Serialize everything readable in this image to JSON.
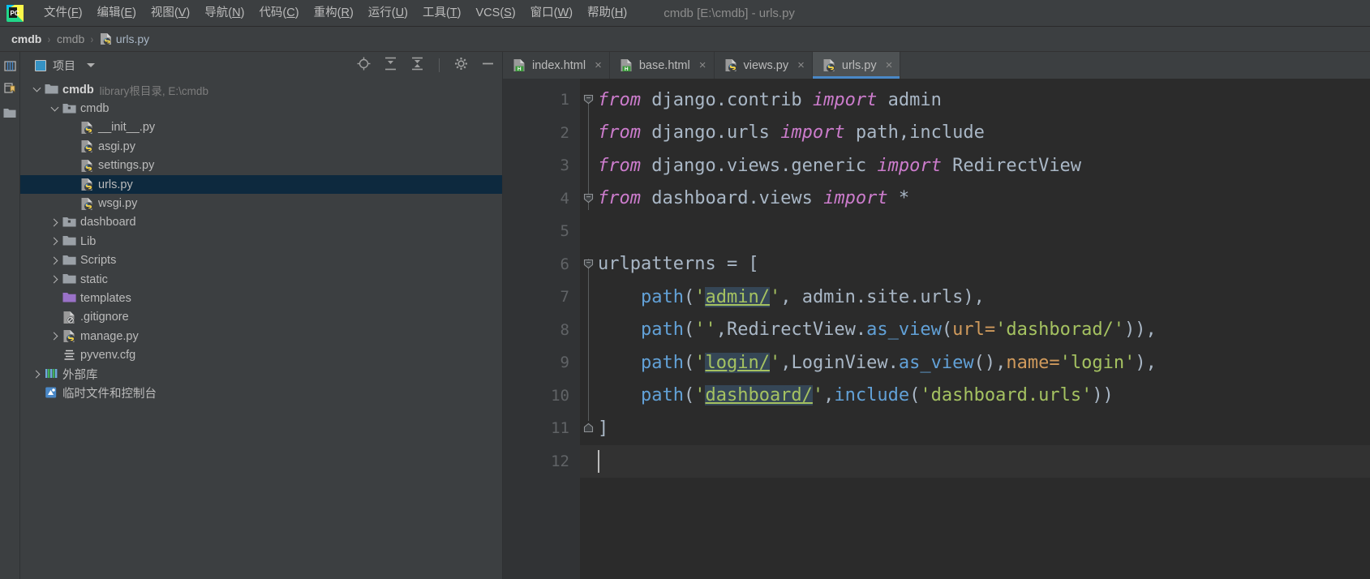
{
  "window": {
    "title": "cmdb [E:\\cmdb] - urls.py",
    "logo_text": "PC"
  },
  "menubar": {
    "items": [
      {
        "label": "文件",
        "mnemonic": "F"
      },
      {
        "label": "编辑",
        "mnemonic": "E"
      },
      {
        "label": "视图",
        "mnemonic": "V"
      },
      {
        "label": "导航",
        "mnemonic": "N"
      },
      {
        "label": "代码",
        "mnemonic": "C"
      },
      {
        "label": "重构",
        "mnemonic": "R"
      },
      {
        "label": "运行",
        "mnemonic": "U"
      },
      {
        "label": "工具",
        "mnemonic": "T"
      },
      {
        "label": "VCS",
        "mnemonic": "S"
      },
      {
        "label": "窗口",
        "mnemonic": "W"
      },
      {
        "label": "帮助",
        "mnemonic": "H"
      }
    ]
  },
  "breadcrumb": {
    "items": [
      "cmdb",
      "cmdb",
      "urls.py"
    ],
    "separator": "›"
  },
  "project_panel": {
    "title": "项目",
    "tools": [
      "locate-icon",
      "expand-all-icon",
      "collapse-all-icon",
      "gear-icon",
      "minimize-icon"
    ],
    "tree": [
      {
        "label": "cmdb",
        "sub": "library根目录, E:\\cmdb",
        "icon": "folder-root-icon",
        "arrow": "down",
        "indent": 0,
        "bold": true,
        "selected": false
      },
      {
        "label": "cmdb",
        "sub": "",
        "icon": "folder-source-icon",
        "arrow": "down",
        "indent": 1,
        "bold": false,
        "selected": false
      },
      {
        "label": "__init__.py",
        "sub": "",
        "icon": "python-file-icon",
        "arrow": "none",
        "indent": 2,
        "bold": false,
        "selected": false
      },
      {
        "label": "asgi.py",
        "sub": "",
        "icon": "python-file-icon",
        "arrow": "none",
        "indent": 2,
        "bold": false,
        "selected": false
      },
      {
        "label": "settings.py",
        "sub": "",
        "icon": "python-file-icon",
        "arrow": "none",
        "indent": 2,
        "bold": false,
        "selected": false
      },
      {
        "label": "urls.py",
        "sub": "",
        "icon": "python-file-icon",
        "arrow": "none",
        "indent": 2,
        "bold": false,
        "selected": true
      },
      {
        "label": "wsgi.py",
        "sub": "",
        "icon": "python-file-icon",
        "arrow": "none",
        "indent": 2,
        "bold": false,
        "selected": false
      },
      {
        "label": "dashboard",
        "sub": "",
        "icon": "folder-source-icon",
        "arrow": "right",
        "indent": 1,
        "bold": false,
        "selected": false
      },
      {
        "label": "Lib",
        "sub": "",
        "icon": "folder-icon",
        "arrow": "right",
        "indent": 1,
        "bold": false,
        "selected": false
      },
      {
        "label": "Scripts",
        "sub": "",
        "icon": "folder-icon",
        "arrow": "right",
        "indent": 1,
        "bold": false,
        "selected": false
      },
      {
        "label": "static",
        "sub": "",
        "icon": "folder-icon",
        "arrow": "right",
        "indent": 1,
        "bold": false,
        "selected": false
      },
      {
        "label": "templates",
        "sub": "",
        "icon": "folder-template-icon",
        "arrow": "none",
        "indent": 1,
        "bold": false,
        "selected": false
      },
      {
        "label": ".gitignore",
        "sub": "",
        "icon": "gitignore-file-icon",
        "arrow": "none",
        "indent": 1,
        "bold": false,
        "selected": false
      },
      {
        "label": "manage.py",
        "sub": "",
        "icon": "python-file-icon",
        "arrow": "right",
        "indent": 1,
        "bold": false,
        "selected": false
      },
      {
        "label": "pyvenv.cfg",
        "sub": "",
        "icon": "config-file-icon",
        "arrow": "none",
        "indent": 1,
        "bold": false,
        "selected": false
      },
      {
        "label": "外部库",
        "sub": "",
        "icon": "library-icon",
        "arrow": "right",
        "indent": 0,
        "bold": false,
        "selected": false
      },
      {
        "label": "临时文件和控制台",
        "sub": "",
        "icon": "scratches-icon",
        "arrow": "none",
        "indent": 0,
        "bold": false,
        "selected": false
      }
    ]
  },
  "editor": {
    "tabs": [
      {
        "label": "index.html",
        "icon": "html-file-icon",
        "active": false,
        "close": "×"
      },
      {
        "label": "base.html",
        "icon": "html-file-icon",
        "active": false,
        "close": "×"
      },
      {
        "label": "views.py",
        "icon": "python-file-icon",
        "active": false,
        "close": "×"
      },
      {
        "label": "urls.py",
        "icon": "python-file-icon",
        "active": true,
        "close": "×"
      }
    ],
    "line_numbers": [
      "1",
      "2",
      "3",
      "4",
      "5",
      "6",
      "7",
      "8",
      "9",
      "10",
      "11",
      "12"
    ],
    "code_lines": [
      {
        "n": 1,
        "fold": "minus",
        "tokens": [
          {
            "t": "from ",
            "c": "kw"
          },
          {
            "t": "django.contrib ",
            "c": "plain"
          },
          {
            "t": "import ",
            "c": "kw"
          },
          {
            "t": "admin",
            "c": "plain"
          }
        ]
      },
      {
        "n": 2,
        "fold": "",
        "tokens": [
          {
            "t": "from ",
            "c": "kw"
          },
          {
            "t": "django.urls ",
            "c": "plain"
          },
          {
            "t": "import ",
            "c": "kw"
          },
          {
            "t": "path,include",
            "c": "plain"
          }
        ]
      },
      {
        "n": 3,
        "fold": "",
        "tokens": [
          {
            "t": "from ",
            "c": "kw"
          },
          {
            "t": "django.views.generic ",
            "c": "plain"
          },
          {
            "t": "import ",
            "c": "kw"
          },
          {
            "t": "RedirectView",
            "c": "plain"
          }
        ]
      },
      {
        "n": 4,
        "fold": "minus",
        "tokens": [
          {
            "t": "from ",
            "c": "kw"
          },
          {
            "t": "dashboard.views ",
            "c": "plain"
          },
          {
            "t": "import ",
            "c": "kw"
          },
          {
            "t": "*",
            "c": "plain"
          }
        ]
      },
      {
        "n": 5,
        "fold": "",
        "tokens": []
      },
      {
        "n": 6,
        "fold": "minus",
        "tokens": [
          {
            "t": "urlpatterns = [",
            "c": "plain"
          }
        ]
      },
      {
        "n": 7,
        "fold": "",
        "tokens": [
          {
            "t": "    ",
            "c": "plain"
          },
          {
            "t": "path",
            "c": "fn"
          },
          {
            "t": "(",
            "c": "plain"
          },
          {
            "t": "'",
            "c": "str"
          },
          {
            "t": "admin/",
            "c": "strU"
          },
          {
            "t": "'",
            "c": "str"
          },
          {
            "t": ", admin.site.urls),",
            "c": "plain"
          }
        ]
      },
      {
        "n": 8,
        "fold": "",
        "tokens": [
          {
            "t": "    ",
            "c": "plain"
          },
          {
            "t": "path",
            "c": "fn"
          },
          {
            "t": "(",
            "c": "plain"
          },
          {
            "t": "''",
            "c": "str"
          },
          {
            "t": ",RedirectView.",
            "c": "plain"
          },
          {
            "t": "as_view",
            "c": "fn"
          },
          {
            "t": "(",
            "c": "plain"
          },
          {
            "t": "url=",
            "c": "arg"
          },
          {
            "t": "'dashborad/'",
            "c": "str"
          },
          {
            "t": ")),",
            "c": "plain"
          }
        ]
      },
      {
        "n": 9,
        "fold": "",
        "tokens": [
          {
            "t": "    ",
            "c": "plain"
          },
          {
            "t": "path",
            "c": "fn"
          },
          {
            "t": "(",
            "c": "plain"
          },
          {
            "t": "'",
            "c": "str"
          },
          {
            "t": "login/",
            "c": "strU"
          },
          {
            "t": "'",
            "c": "str"
          },
          {
            "t": ",LoginView.",
            "c": "plain"
          },
          {
            "t": "as_view",
            "c": "fn"
          },
          {
            "t": "(),",
            "c": "plain"
          },
          {
            "t": "name=",
            "c": "arg"
          },
          {
            "t": "'login'",
            "c": "str"
          },
          {
            "t": "),",
            "c": "plain"
          }
        ]
      },
      {
        "n": 10,
        "fold": "",
        "tokens": [
          {
            "t": "    ",
            "c": "plain"
          },
          {
            "t": "path",
            "c": "fn"
          },
          {
            "t": "(",
            "c": "plain"
          },
          {
            "t": "'",
            "c": "str"
          },
          {
            "t": "dashboard/",
            "c": "strU"
          },
          {
            "t": "'",
            "c": "str"
          },
          {
            "t": ",",
            "c": "plain"
          },
          {
            "t": "include",
            "c": "fn"
          },
          {
            "t": "(",
            "c": "plain"
          },
          {
            "t": "'dashboard.urls'",
            "c": "str"
          },
          {
            "t": "))",
            "c": "plain"
          }
        ]
      },
      {
        "n": 11,
        "fold": "plus-end",
        "tokens": [
          {
            "t": "]",
            "c": "plain"
          }
        ]
      },
      {
        "n": 12,
        "fold": "",
        "tokens": [],
        "caret": true
      }
    ]
  },
  "colors": {
    "chrome": "#3c3f41",
    "editor_bg": "#2b2b2b",
    "gutter_bg": "#313335",
    "selection": "#0d293e",
    "accent": "#4a88c7",
    "keyword": "#cc7ccc",
    "string": "#a5c261",
    "function": "#62a1d7",
    "kwarg": "#d09a5c",
    "text": "#a9b7c6"
  }
}
